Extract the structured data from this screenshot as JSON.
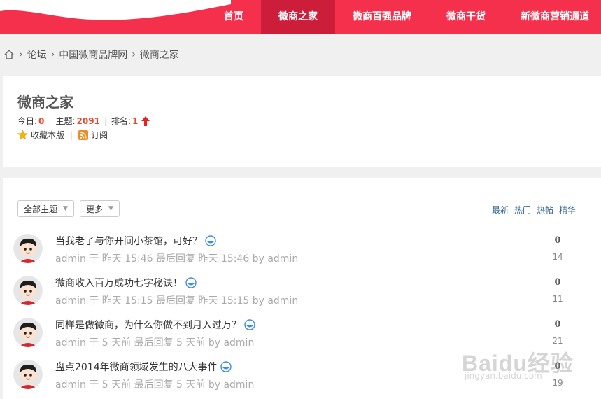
{
  "header": {
    "nav": [
      {
        "label": "首页",
        "active": false
      },
      {
        "label": "微商之家",
        "active": true
      },
      {
        "label": "微商百强品牌",
        "active": false
      },
      {
        "label": "微商干货",
        "active": false
      },
      {
        "label": "新微商营销通道",
        "active": false
      }
    ],
    "colors": {
      "primary": "#f5304c",
      "active": "#cc1e3b"
    }
  },
  "breadcrumb": {
    "home_icon": "home-icon",
    "items": [
      "论坛",
      "中国微商品牌网",
      "微商之家"
    ]
  },
  "forum": {
    "title": "微商之家",
    "today_label": "今日:",
    "today_value": "0",
    "topics_label": "主题:",
    "topics_value": "2091",
    "rank_label": "排名:",
    "rank_value": "1",
    "rank_icon": "arrow-up-icon",
    "favorite_label": "收藏本版",
    "subscribe_label": "订阅"
  },
  "filters": {
    "type_select": "全部主题",
    "more_select": "更多",
    "sort": [
      "最新",
      "热门",
      "热帖",
      "精华"
    ]
  },
  "threads": [
    {
      "title": "当我老了与你开间小茶馆，可好？",
      "meta": "admin 于 昨天 15:46 最后回复 昨天 15:46 by admin",
      "replies": "0",
      "views": "14"
    },
    {
      "title": "微商收入百万成功七字秘诀！",
      "meta": "admin 于 昨天 15:15 最后回复 昨天 15:15 by admin",
      "replies": "0",
      "views": "11"
    },
    {
      "title": "同样是做微商，为什么你做不到月入过万？",
      "meta": "admin 于 5 天前 最后回复 5 天前 by admin",
      "replies": "0",
      "views": "21"
    },
    {
      "title": "盘点2014年微商领域发生的八大事件",
      "meta": "admin 于 5 天前 最后回复 5 天前 by admin",
      "replies": "0",
      "views": "19"
    }
  ],
  "watermark": {
    "text": "Baidu经验",
    "sub": "jingyan.baidu.com"
  }
}
